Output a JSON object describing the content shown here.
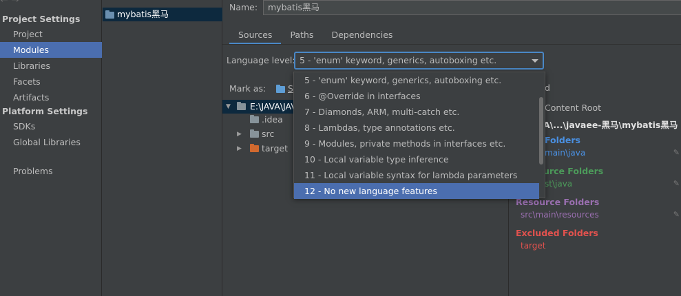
{
  "sidebar": {
    "nav_arrows": "← →",
    "section_project": "Project Settings",
    "section_platform": "Platform Settings",
    "items": [
      {
        "label": "Project"
      },
      {
        "label": "Modules"
      },
      {
        "label": "Libraries"
      },
      {
        "label": "Facets"
      },
      {
        "label": "Artifacts"
      },
      {
        "label": "SDKs"
      },
      {
        "label": "Global Libraries"
      },
      {
        "label": "Problems"
      }
    ]
  },
  "modules": {
    "items": [
      {
        "label": "mybatis黑马"
      }
    ]
  },
  "main": {
    "name_label": "Name:",
    "name_value": "mybatis黑马",
    "tabs": [
      {
        "label": "Sources"
      },
      {
        "label": "Paths"
      },
      {
        "label": "Dependencies"
      }
    ],
    "language_label": "Language level:",
    "language_value": "5 - 'enum' keyword, generics, autoboxing etc.",
    "mark_as_label": "Mark as:",
    "mark_sources_label": "S"
  },
  "tree": {
    "root": "E:\\JAVA\\JAV",
    "children": [
      {
        "label": ".idea"
      },
      {
        "label": "src"
      },
      {
        "label": "target"
      }
    ]
  },
  "right_panel": {
    "add_label": "d",
    "add_content_root": "Content Root",
    "path": "A\\...\\javaee-黑马\\mybatis黑马",
    "source_folders_head": "Folders",
    "source_folders_item": "main\\java",
    "test_folders_head": "urce Folders",
    "test_folders_item": "st\\java",
    "resource_folders_head": "Resource Folders",
    "resource_folders_item": "src\\main\\resources",
    "excluded_folders_head": "Excluded Folders",
    "excluded_folders_item": "target",
    "colors": {
      "source": "#4a90e2",
      "test": "#4c9a5a",
      "resource": "#9a6fb0",
      "excluded": "#e2524e"
    }
  },
  "dropdown": {
    "options": [
      {
        "label": "5 - 'enum' keyword, generics, autoboxing etc."
      },
      {
        "label": "6 - @Override in interfaces"
      },
      {
        "label": "7 - Diamonds, ARM, multi-catch etc."
      },
      {
        "label": "8 - Lambdas, type annotations etc."
      },
      {
        "label": "9 - Modules, private methods in interfaces etc."
      },
      {
        "label": "10 - Local variable type inference"
      },
      {
        "label": "11 - Local variable syntax for lambda parameters"
      },
      {
        "label": "12 - No new language features"
      }
    ],
    "selected": "12 - No new language features"
  }
}
